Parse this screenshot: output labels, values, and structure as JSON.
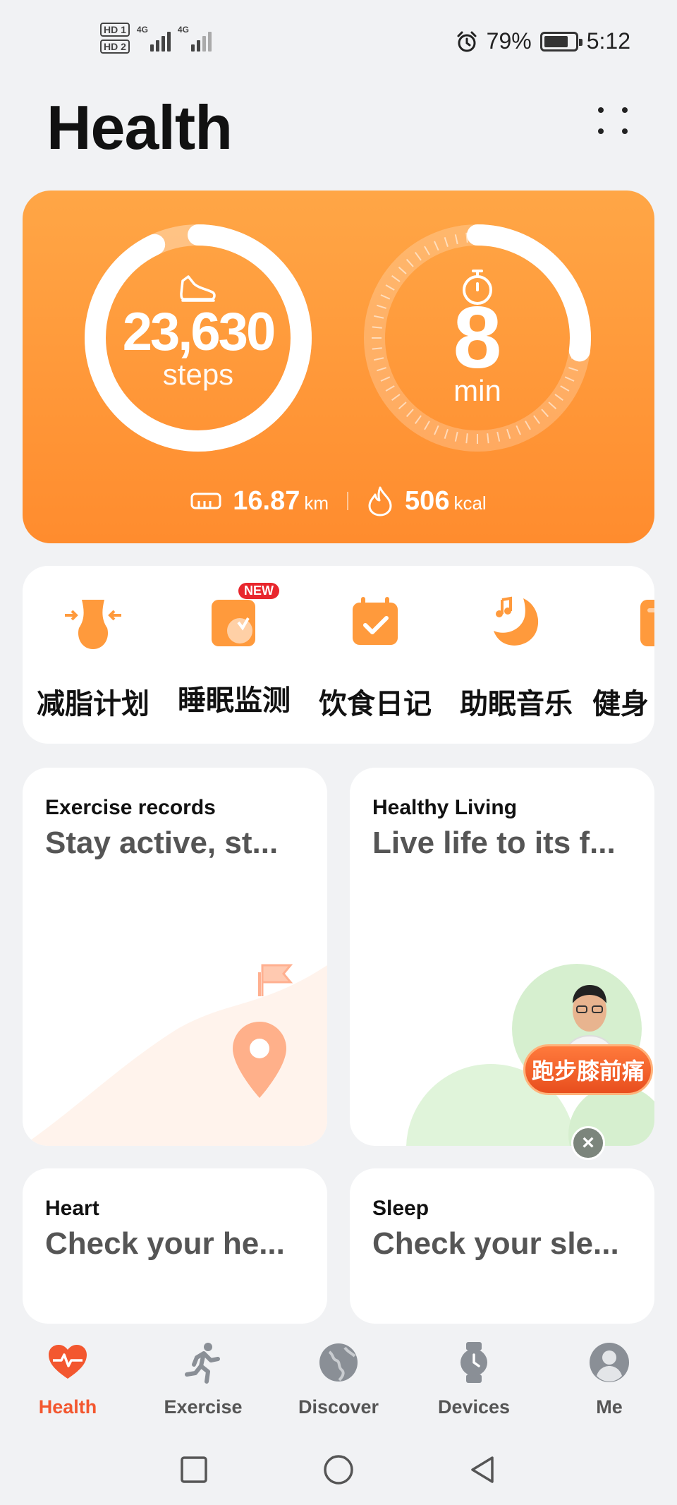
{
  "status_bar": {
    "hd1": "HD 1",
    "hd2": "HD 2",
    "net1": "4G",
    "net2": "4G",
    "battery_percent": "79%",
    "time": "5:12"
  },
  "header": {
    "title": "Health"
  },
  "hero": {
    "steps_value": "23,630",
    "steps_unit": "steps",
    "steps_progress": 0.93,
    "active_minutes_value": "8",
    "active_minutes_unit": "min",
    "active_minutes_progress": 0.27,
    "distance_value": "16.87",
    "distance_unit": "km",
    "calories_value": "506",
    "calories_unit": "kcal",
    "colors": {
      "card": "#ff9a3c",
      "ring": "#ffffff"
    }
  },
  "quick_actions": {
    "items": [
      {
        "label": "减脂计划",
        "icon": "waist-icon"
      },
      {
        "label": "睡眠监测",
        "icon": "sleep-monitor-icon",
        "badge": "NEW"
      },
      {
        "label": "饮食日记",
        "icon": "calendar-check-icon"
      },
      {
        "label": "助眠音乐",
        "icon": "moon-music-icon"
      },
      {
        "label": "健身",
        "icon": "fitness-icon"
      }
    ]
  },
  "cards": {
    "exercise": {
      "title": "Exercise records",
      "subtitle": "Stay active, st..."
    },
    "healthy": {
      "title": "Healthy Living",
      "subtitle": "Live life to its f..."
    },
    "heart": {
      "title": "Heart",
      "subtitle": "Check your he..."
    },
    "sleep": {
      "title": "Sleep",
      "subtitle": "Check your sle..."
    }
  },
  "promo": {
    "label": "跑步膝前痛"
  },
  "tabs": [
    {
      "label": "Health",
      "icon": "heart-pulse-icon",
      "active": true
    },
    {
      "label": "Exercise",
      "icon": "runner-icon",
      "active": false
    },
    {
      "label": "Discover",
      "icon": "globe-icon",
      "active": false
    },
    {
      "label": "Devices",
      "icon": "watch-icon",
      "active": false
    },
    {
      "label": "Me",
      "icon": "person-icon",
      "active": false
    }
  ],
  "accent_color": "#f3572f"
}
